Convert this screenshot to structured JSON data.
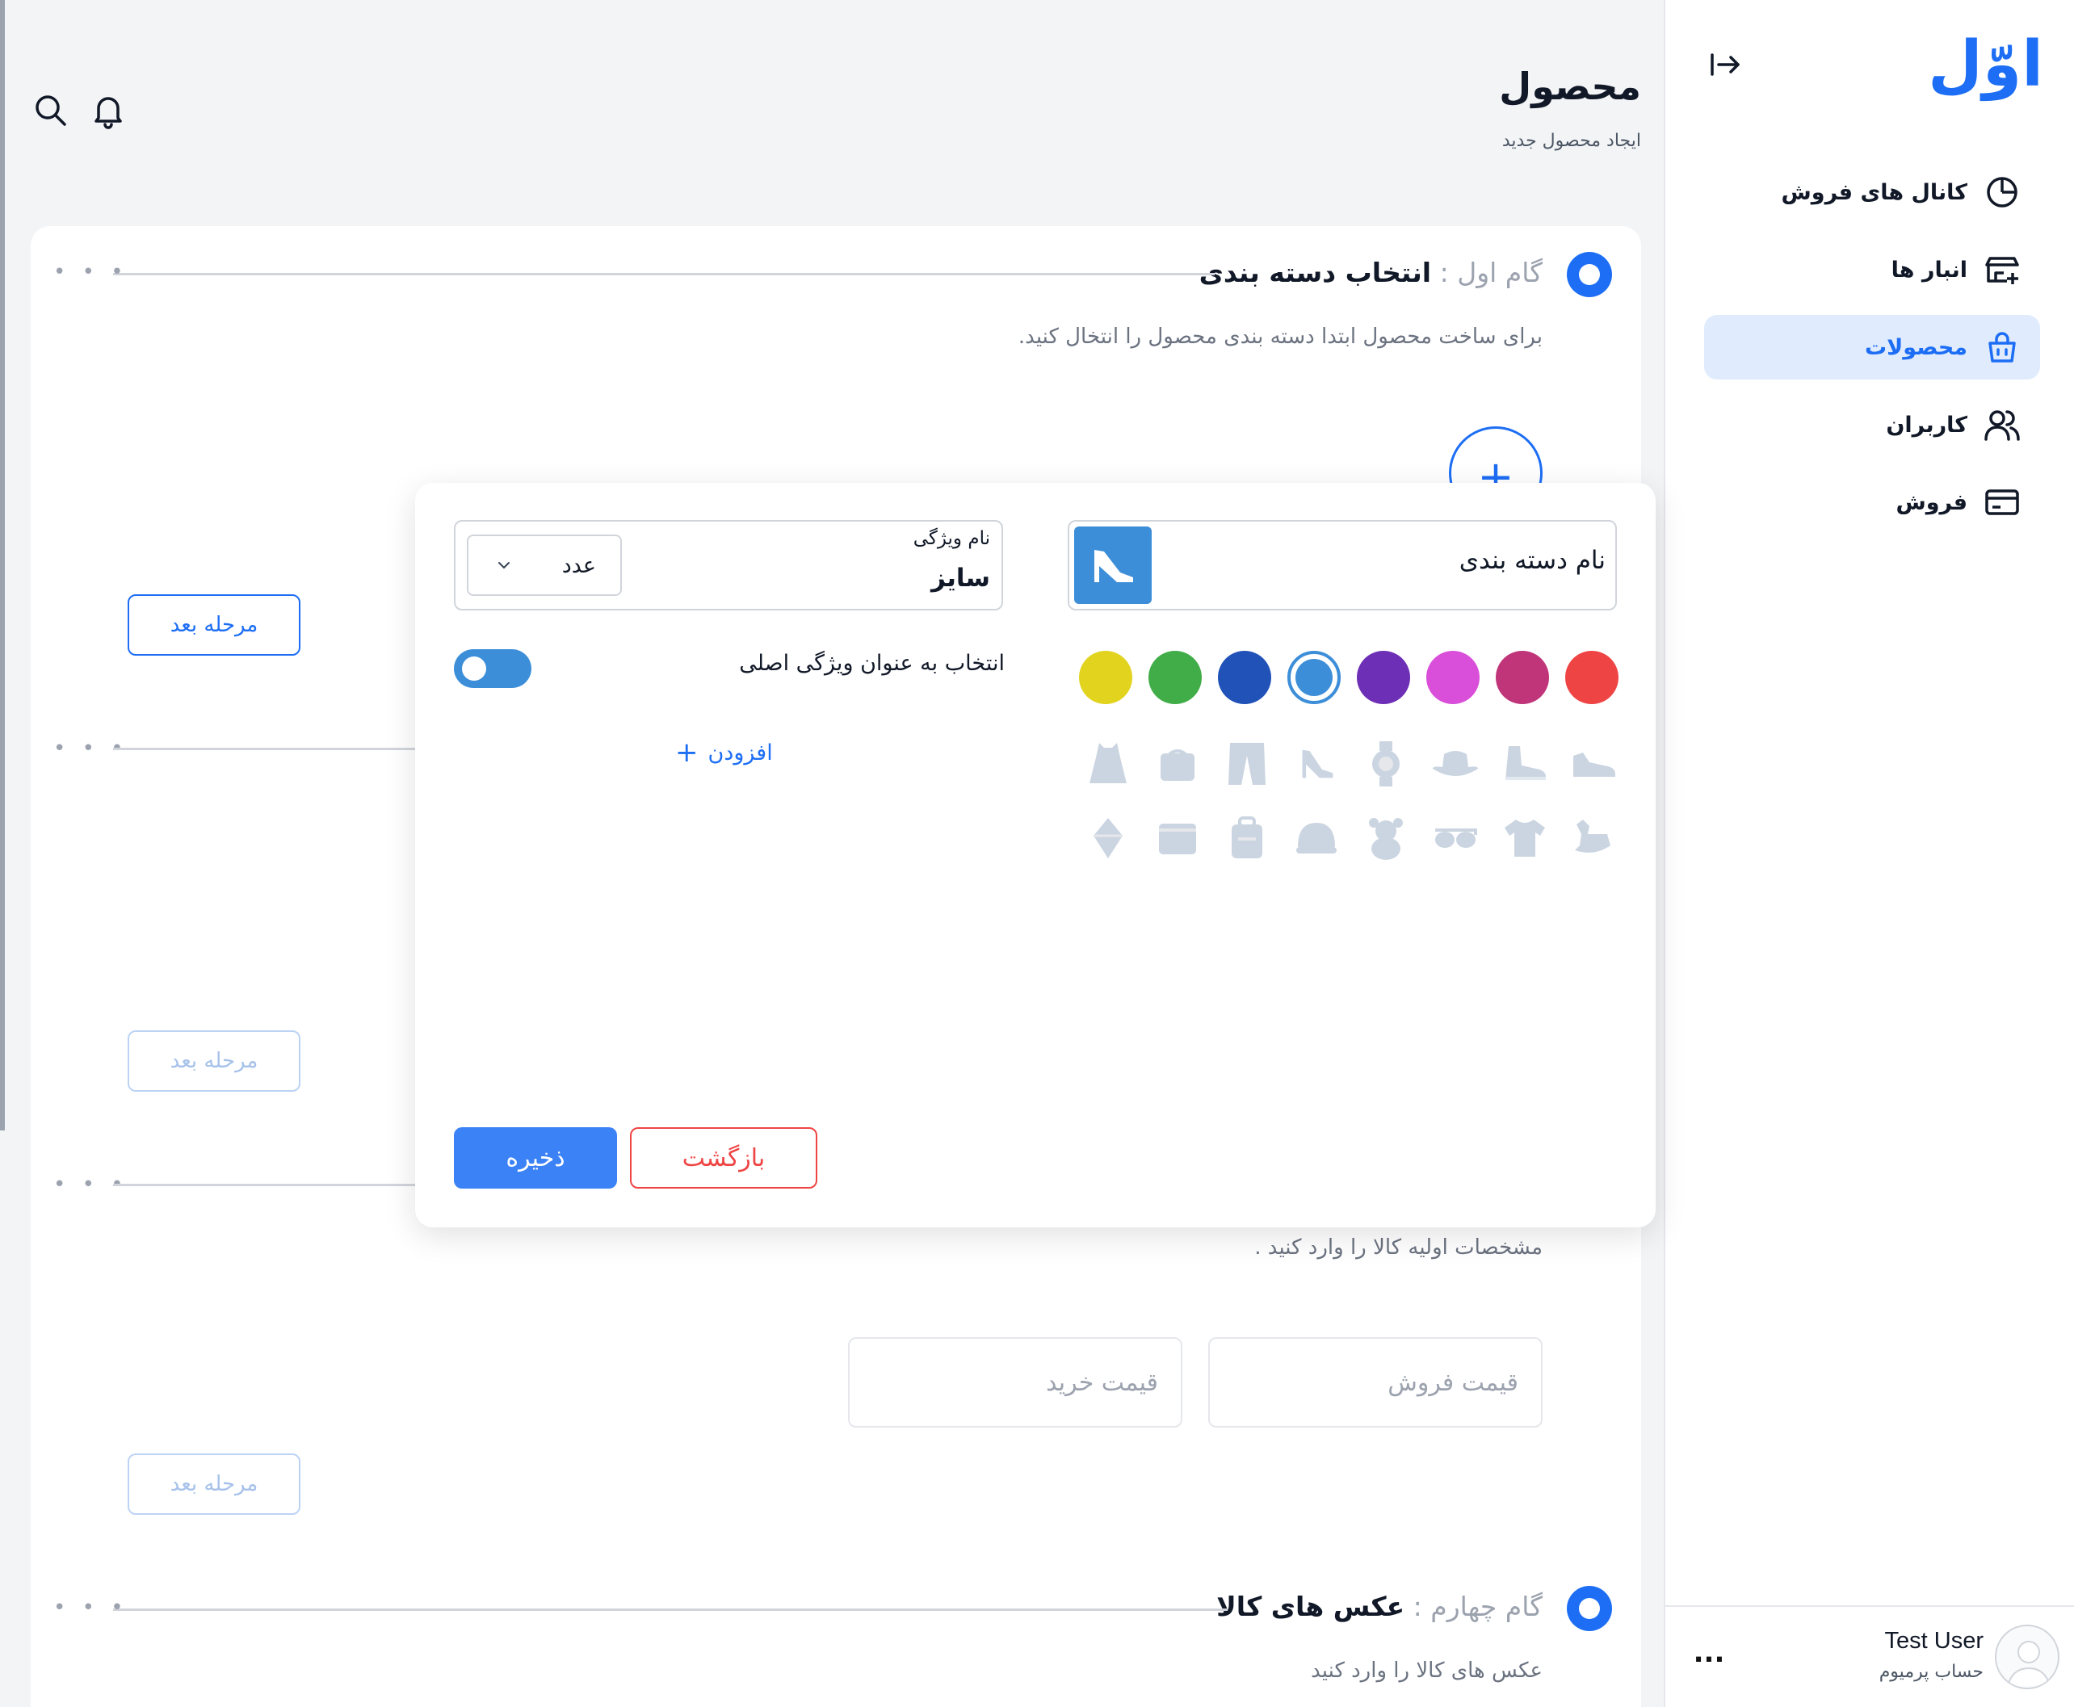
{
  "app": {
    "logo_text": "اوّل",
    "brand_color": "#1d6ef5"
  },
  "sidebar": {
    "items": [
      {
        "label": "کانال های فروش",
        "icon": "pie-chart-icon",
        "active": false
      },
      {
        "label": "انبار ها",
        "icon": "warehouse-add-icon",
        "active": false
      },
      {
        "label": "محصولات",
        "icon": "shopping-bag-icon",
        "active": true
      },
      {
        "label": "کاربران",
        "icon": "users-icon",
        "active": false
      },
      {
        "label": "فروش",
        "icon": "credit-card-icon",
        "active": false
      }
    ]
  },
  "user": {
    "name": "Test User",
    "plan": "حساب پرمیوم",
    "more": "..."
  },
  "header": {
    "title": "محصول",
    "subtitle": "ایجاد محصول جدید"
  },
  "steps": {
    "step1": {
      "number": "گام اول",
      "separator": " : ",
      "name": "انتخاب دسته بندی",
      "description": "برای ساخت محصول ابتدا دسته بندی محصول را انتخال کنید.",
      "next_label": "مرحله بعد"
    },
    "step2": {
      "next_label": "مرحله بعد"
    },
    "step3": {
      "description": "مشخصات اولیه کالا را وارد کنید .",
      "sell_price_placeholder": "قیمت فروش",
      "buy_price_placeholder": "قیمت خرید",
      "next_label": "مرحله بعد"
    },
    "step4": {
      "number": "گام چهارم",
      "separator": " : ",
      "name": "عکس های کالا",
      "description": "عکس های کالا را وارد کنید"
    },
    "dots": "• • •",
    "add_symbol": "+"
  },
  "modal": {
    "category_name_label": "نام دسته بندی",
    "selected_icon": "high-heel-icon",
    "attribute_label": "نام ویژگی",
    "attribute_value": "سایز",
    "unit_value": "عدد",
    "main_attribute_label": "انتخاب به عنوان ویژگی اصلی",
    "main_attribute_on": true,
    "add_label": "افزودن",
    "add_symbol": "+",
    "back_label": "بازگشت",
    "save_label": "ذخیره",
    "colors": [
      "#ef4444",
      "#c0357a",
      "#d94fd9",
      "#6d2fb5",
      "#3d8ed9",
      "#2052b8",
      "#41ad48",
      "#e2d31f"
    ],
    "selected_color": "#3d8ed9",
    "category_icons_row1": [
      "sneaker-icon",
      "high-top-sneaker-icon",
      "hat-icon",
      "watch-icon",
      "high-heel-icon",
      "pants-icon",
      "bag-icon",
      "dress-icon"
    ],
    "category_icons_row2": [
      "rocking-horse-icon",
      "tshirt-icon",
      "sunglasses-icon",
      "teddy-bear-icon",
      "cap-icon",
      "backpack-icon",
      "wallet-icon",
      "diamond-icon"
    ]
  }
}
